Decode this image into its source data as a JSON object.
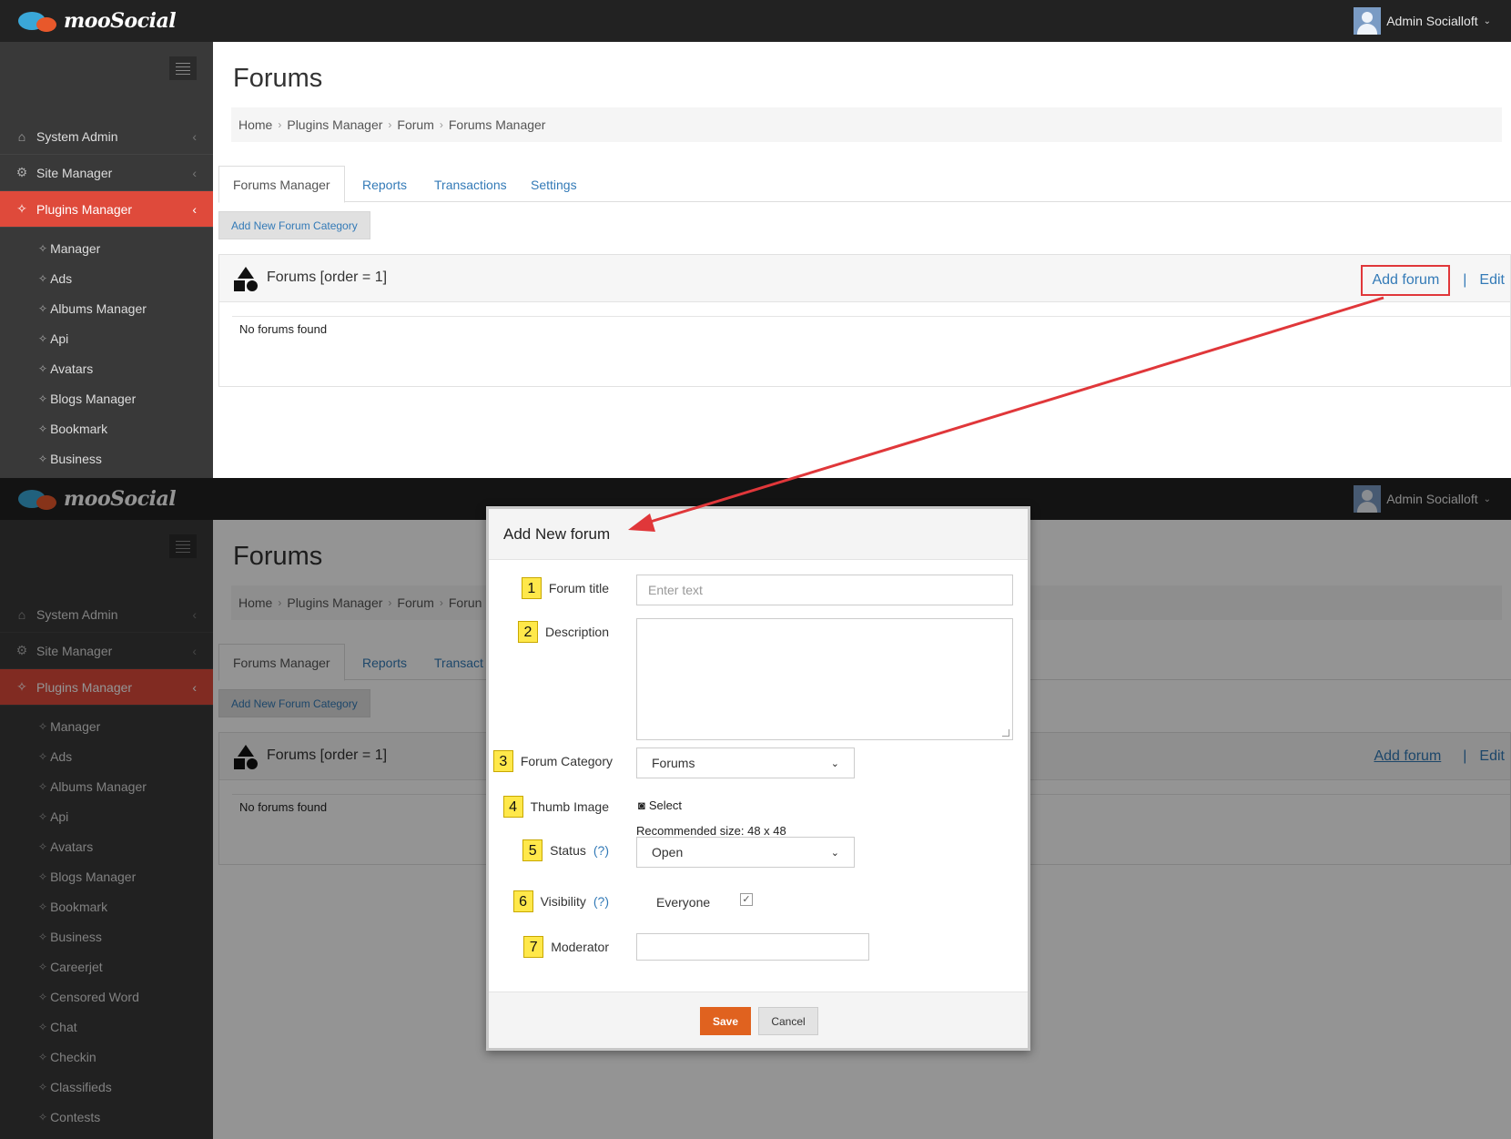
{
  "app": {
    "brand": "mooSocial",
    "user_name": "Admin Socialloft"
  },
  "sidebar": {
    "items": [
      {
        "label": "System Admin",
        "icon": "home-icon"
      },
      {
        "label": "Site Manager",
        "icon": "gears-icon"
      },
      {
        "label": "Plugins Manager",
        "icon": "puzzle-icon",
        "active": true
      }
    ],
    "sub_top": [
      "Manager",
      "Ads",
      "Albums Manager",
      "Api",
      "Avatars",
      "Blogs Manager",
      "Bookmark",
      "Business"
    ],
    "sub_bottom": [
      "Manager",
      "Ads",
      "Albums Manager",
      "Api",
      "Avatars",
      "Blogs Manager",
      "Bookmark",
      "Business",
      "Careerjet",
      "Censored Word",
      "Chat",
      "Checkin",
      "Classifieds",
      "Contests"
    ]
  },
  "page": {
    "title": "Forums",
    "breadcrumb": [
      "Home",
      "Plugins Manager",
      "Forum",
      "Forums Manager"
    ],
    "breadcrumb_bottom": [
      "Home",
      "Plugins Manager",
      "Forum",
      "Forun"
    ],
    "tabs": [
      "Forums Manager",
      "Reports",
      "Transactions",
      "Settings"
    ],
    "tabs_bottom": [
      "Forums Manager",
      "Reports",
      "Transact"
    ],
    "add_category_label": "Add New Forum Category",
    "panel": {
      "title": "Forums [order = 1]",
      "add_forum": "Add forum",
      "separator": "|",
      "edit": "Edit",
      "empty": "No forums found"
    }
  },
  "modal": {
    "title": "Add New forum",
    "fields": [
      {
        "num": "1",
        "label": "Forum title",
        "placeholder": "Enter text"
      },
      {
        "num": "2",
        "label": "Description"
      },
      {
        "num": "3",
        "label": "Forum Category",
        "value": "Forums"
      },
      {
        "num": "4",
        "label": "Thumb Image",
        "select_label": "Select",
        "recommended": "Recommended size: 48 x 48"
      },
      {
        "num": "5",
        "label": "Status",
        "help": "(?)",
        "value": "Open"
      },
      {
        "num": "6",
        "label": "Visibility",
        "help": "(?)",
        "value": "Everyone",
        "checked": true
      },
      {
        "num": "7",
        "label": "Moderator",
        "value": ""
      }
    ],
    "save": "Save",
    "cancel": "Cancel"
  },
  "colors": {
    "accent_red": "#df4a3b",
    "save_orange": "#e0621f",
    "link_blue": "#337ab7",
    "highlight_box": "#e0373a",
    "callout_yellow": "#ffe84a"
  }
}
